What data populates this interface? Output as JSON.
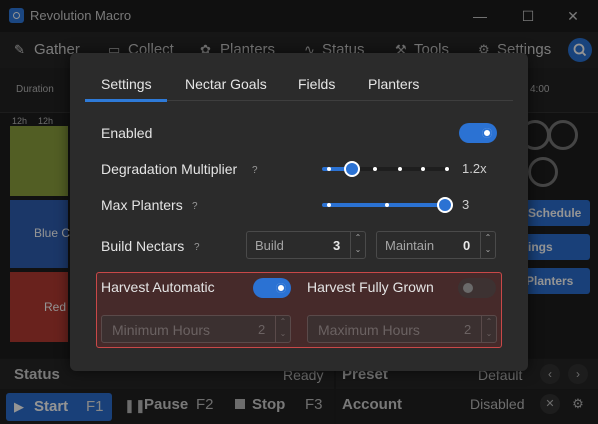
{
  "window": {
    "title": "Revolution Macro",
    "minimize": "—",
    "maximize": "☐",
    "close": "✕"
  },
  "nav": {
    "tabs": [
      "Gather",
      "Collect",
      "Planters",
      "Status",
      "Tools",
      "Settings"
    ]
  },
  "background": {
    "duration_label": "Duration",
    "time_label": "4:00",
    "hours": [
      "12h",
      "12h"
    ],
    "fields": [
      "Blue C",
      "Red"
    ],
    "buttons": [
      "Schedule",
      "ings",
      "Planters"
    ]
  },
  "footer": {
    "status_label": "Status",
    "status_value": "Ready",
    "preset_label": "Preset",
    "preset_value": "Default",
    "start_label": "Start",
    "start_key": "F1",
    "pause_label": "Pause",
    "pause_key": "F2",
    "stop_label": "Stop",
    "stop_key": "F3",
    "account_label": "Account",
    "account_value": "Disabled"
  },
  "dialog": {
    "tabs": [
      "Settings",
      "Nectar Goals",
      "Fields",
      "Planters"
    ],
    "active_tab": "Settings",
    "help_glyph": "?",
    "enabled": {
      "label": "Enabled",
      "on": true
    },
    "degradation": {
      "label": "Degradation Multiplier",
      "value": "1.2x",
      "fraction": 0.0
    },
    "max_planters": {
      "label": "Max Planters",
      "value": "3",
      "fraction": 1.0
    },
    "build_nectars": {
      "label": "Build Nectars",
      "build_label": "Build",
      "build_value": "3",
      "maintain_label": "Maintain",
      "maintain_value": "0"
    },
    "harvest_automatic": {
      "label": "Harvest Automatic",
      "on": true
    },
    "harvest_full": {
      "label": "Harvest Fully Grown",
      "on": false
    },
    "min_hours": {
      "label": "Minimum Hours",
      "value": "2"
    },
    "max_hours": {
      "label": "Maximum Hours",
      "value": "2"
    }
  },
  "colors": {
    "accent": "#2b72d3",
    "highlight_border": "#c94848"
  }
}
